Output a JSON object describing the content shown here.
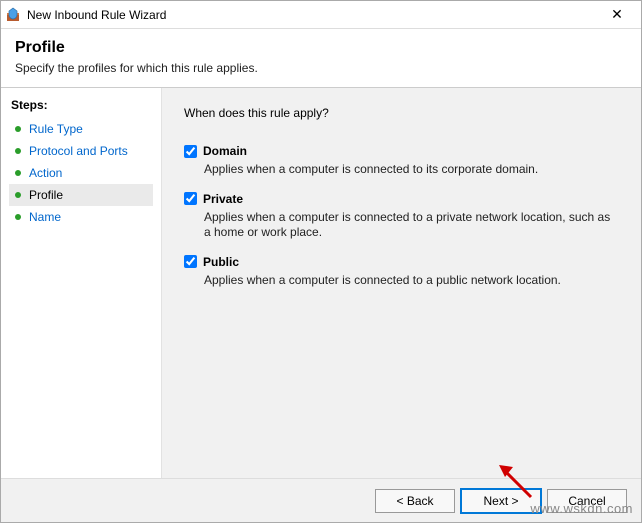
{
  "window": {
    "title": "New Inbound Rule Wizard",
    "close_glyph": "✕"
  },
  "header": {
    "title": "Profile",
    "subtitle": "Specify the profiles for which this rule applies."
  },
  "steps": {
    "title": "Steps:",
    "items": [
      {
        "label": "Rule Type",
        "current": false
      },
      {
        "label": "Protocol and Ports",
        "current": false
      },
      {
        "label": "Action",
        "current": false
      },
      {
        "label": "Profile",
        "current": true
      },
      {
        "label": "Name",
        "current": false
      }
    ]
  },
  "content": {
    "prompt": "When does this rule apply?",
    "options": [
      {
        "name": "Domain",
        "desc": "Applies when a computer is connected to its corporate domain.",
        "checked": true
      },
      {
        "name": "Private",
        "desc": "Applies when a computer is connected to a private network location, such as a home or work place.",
        "checked": true
      },
      {
        "name": "Public",
        "desc": "Applies when a computer is connected to a public network location.",
        "checked": true
      }
    ]
  },
  "footer": {
    "back": "< Back",
    "next": "Next >",
    "cancel": "Cancel"
  },
  "watermark": "www.wskdn.com",
  "arrow_color": "#d00000"
}
